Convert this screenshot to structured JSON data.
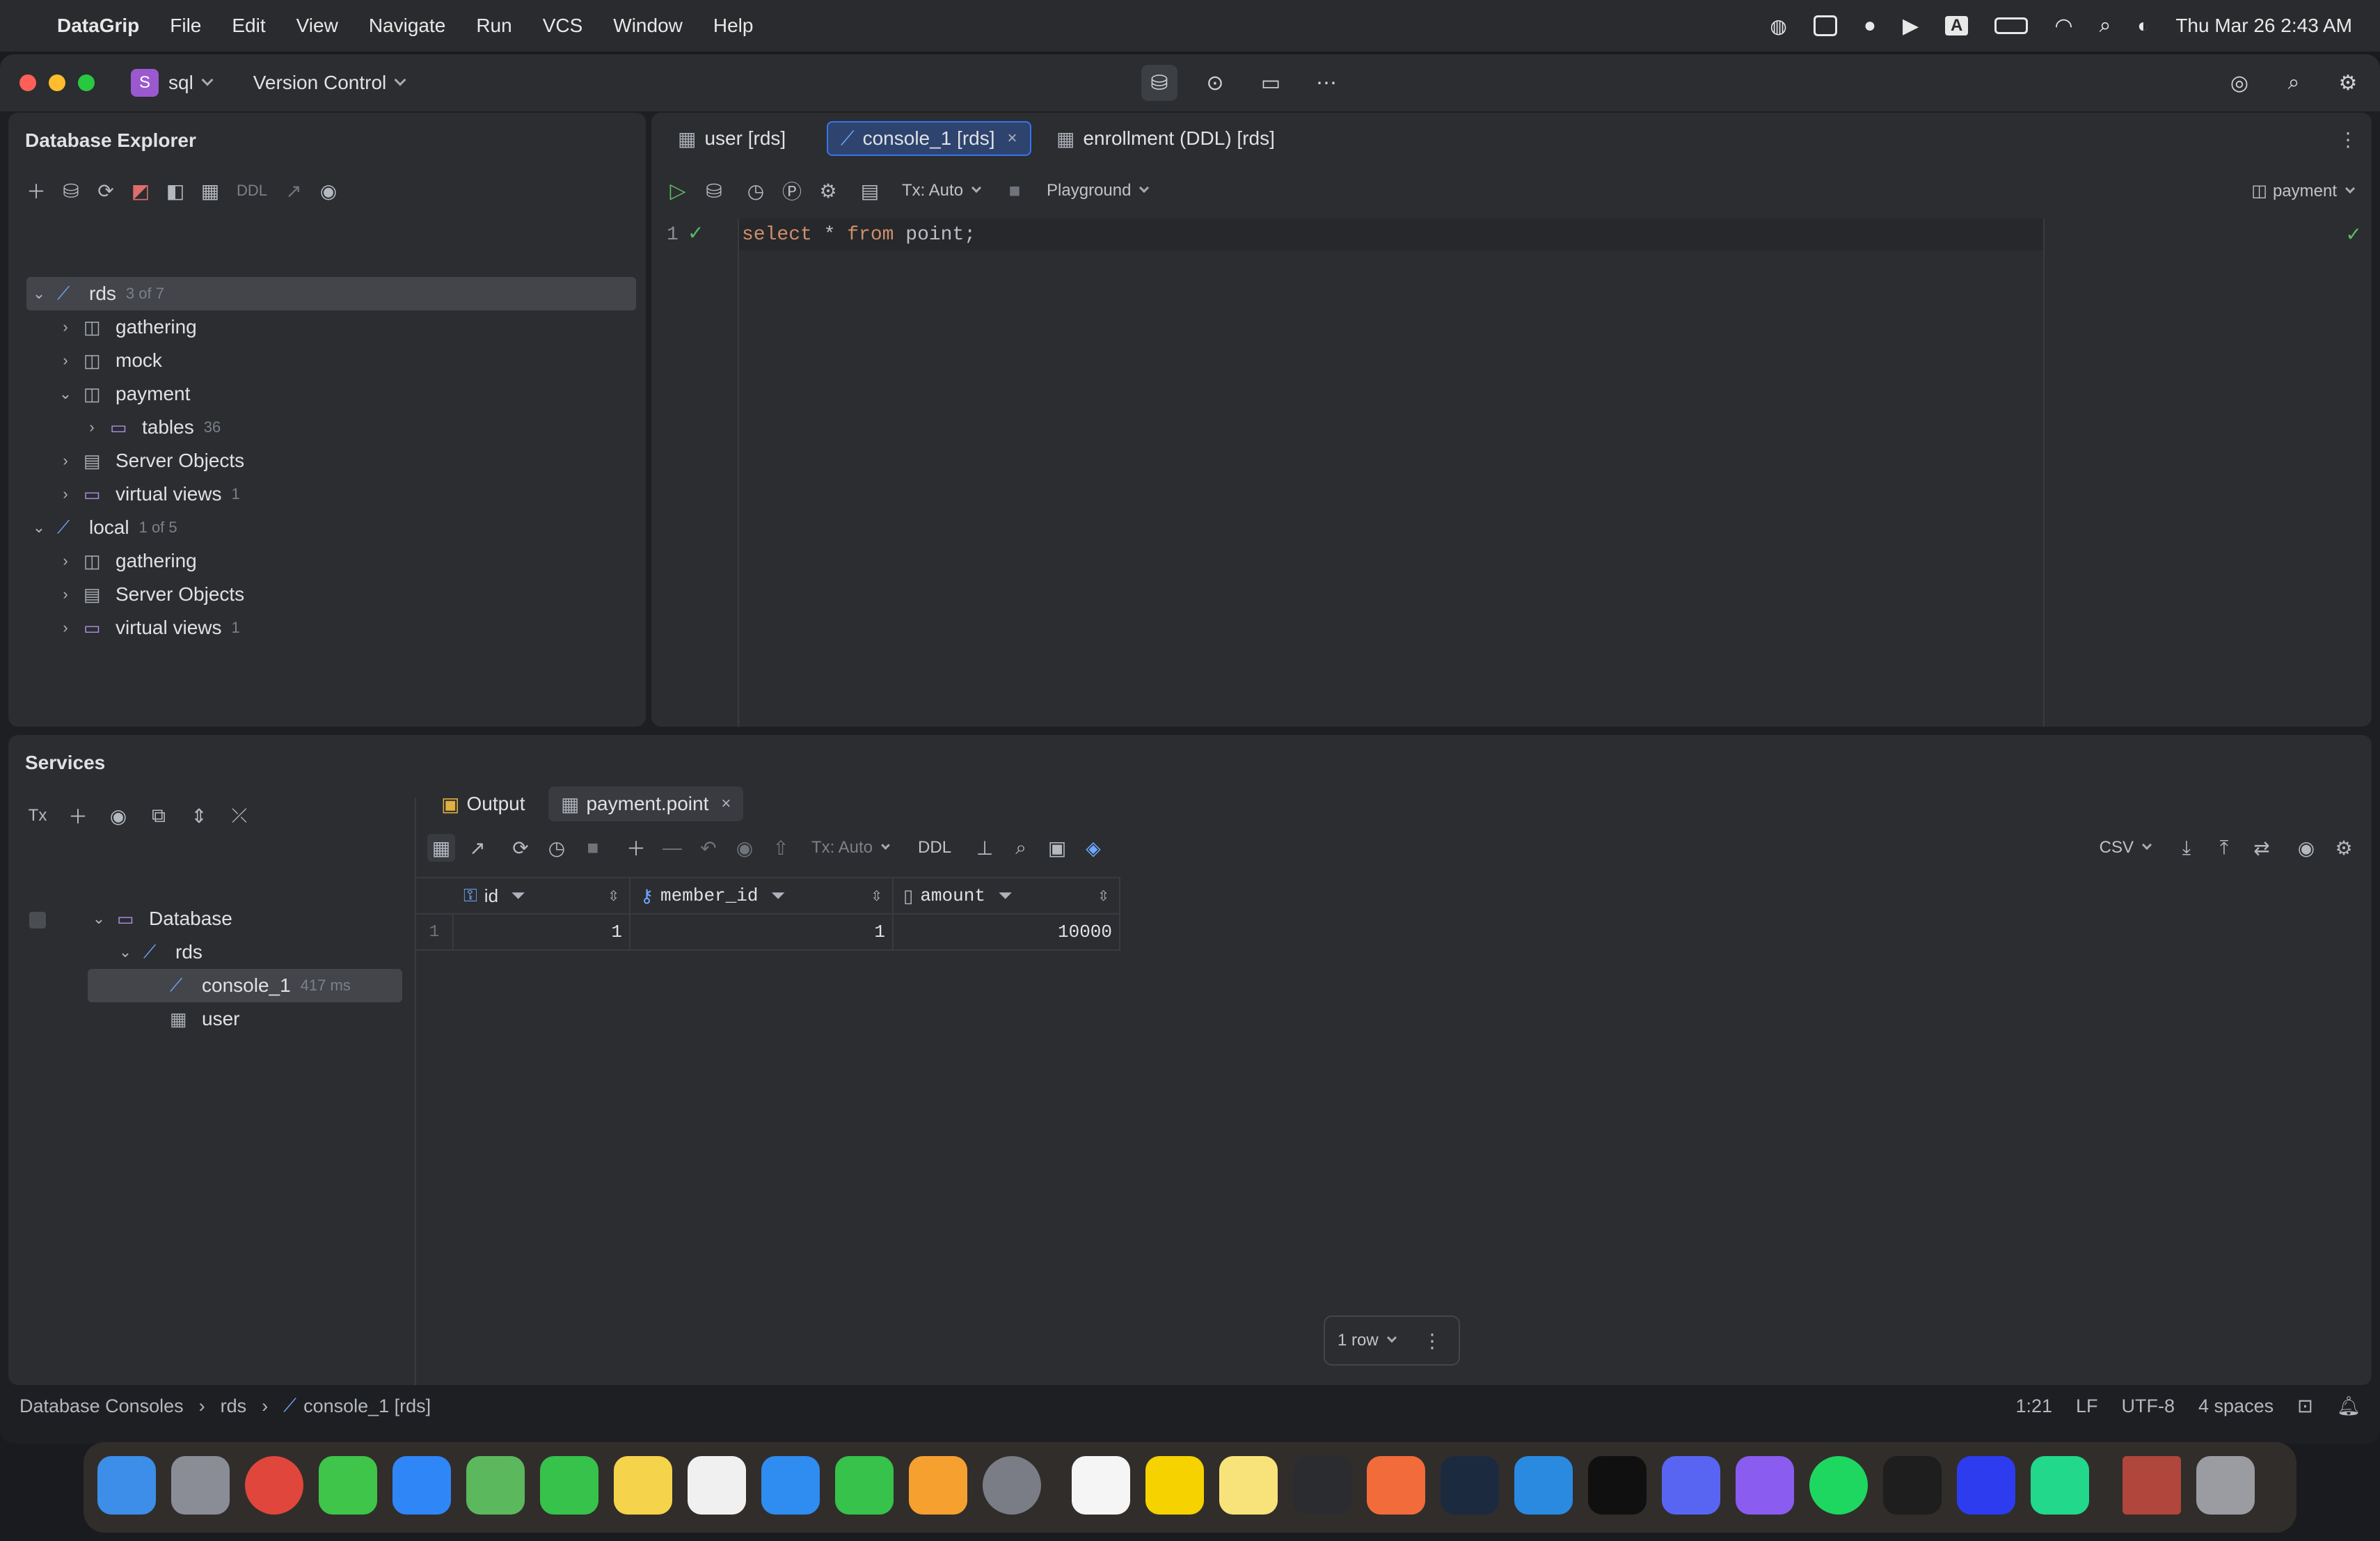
{
  "menubar": {
    "apple": "",
    "app_name": "DataGrip",
    "items": [
      "File",
      "Edit",
      "View",
      "Navigate",
      "Run",
      "VCS",
      "Window",
      "Help"
    ],
    "clock": "Thu Mar 26  2:43 AM",
    "input_source": "A"
  },
  "titlebar": {
    "project_badge": "S",
    "project_name": "sql",
    "version_control": "Version Control"
  },
  "db_explorer": {
    "title": "Database Explorer",
    "toolbar_ddl": "DDL",
    "tree": [
      {
        "label": "rds",
        "count": "3 of 7",
        "level": 0,
        "expanded": true,
        "icon": "datasource-icon",
        "selected": true
      },
      {
        "label": "gathering",
        "count": "",
        "level": 1,
        "expanded": false,
        "icon": "schema-icon"
      },
      {
        "label": "mock",
        "count": "",
        "level": 1,
        "expanded": false,
        "icon": "schema-icon"
      },
      {
        "label": "payment",
        "count": "",
        "level": 1,
        "expanded": true,
        "icon": "schema-icon"
      },
      {
        "label": "tables",
        "count": "36",
        "level": 2,
        "expanded": false,
        "icon": "folder-icon"
      },
      {
        "label": "Server Objects",
        "count": "",
        "level": 1,
        "expanded": false,
        "icon": "server-objects-icon"
      },
      {
        "label": "virtual views",
        "count": "1",
        "level": 1,
        "expanded": false,
        "icon": "folder-icon"
      },
      {
        "label": "local",
        "count": "1 of 5",
        "level": 0,
        "expanded": true,
        "icon": "datasource-icon"
      },
      {
        "label": "gathering",
        "count": "",
        "level": 1,
        "expanded": false,
        "icon": "schema-icon"
      },
      {
        "label": "Server Objects",
        "count": "",
        "level": 1,
        "expanded": false,
        "icon": "server-objects-icon"
      },
      {
        "label": "virtual views",
        "count": "1",
        "level": 1,
        "expanded": false,
        "icon": "folder-icon"
      }
    ]
  },
  "editor": {
    "tabs": [
      {
        "label": "user [rds]",
        "active": false
      },
      {
        "label": "console_1 [rds]",
        "active": true
      },
      {
        "label": "enrollment (DDL) [rds]",
        "active": false
      }
    ],
    "tx_mode": "Tx: Auto",
    "playground": "Playground",
    "schema": "payment",
    "line_number": "1",
    "code": {
      "kw1": "select",
      "star": " * ",
      "kw2": "from",
      "ident": " point",
      "semi": ";"
    }
  },
  "services": {
    "title": "Services",
    "tx_label": "Tx",
    "tree": [
      {
        "label": "Database",
        "level": 0,
        "icon": "folder-icon",
        "extra": ""
      },
      {
        "label": "rds",
        "level": 1,
        "icon": "datasource-icon",
        "extra": ""
      },
      {
        "label": "console_1",
        "level": 2,
        "icon": "console-icon",
        "extra": "417 ms",
        "selected": true
      },
      {
        "label": "user",
        "level": 2,
        "icon": "table-icon",
        "extra": ""
      }
    ],
    "tabs": [
      {
        "label": "Output",
        "active": false
      },
      {
        "label": "payment.point",
        "active": true
      }
    ],
    "toolbar_tx": "Tx: Auto",
    "toolbar_ddl": "DDL",
    "export_format": "CSV",
    "columns": [
      "id",
      "member_id",
      "amount"
    ],
    "rows": [
      {
        "num": "1",
        "cells": [
          "1",
          "1",
          "10000"
        ]
      }
    ],
    "row_count": "1 row"
  },
  "statusbar": {
    "breadcrumb": [
      "Database Consoles",
      "rds",
      "console_1 [rds]"
    ],
    "position": "1:21",
    "line_sep": "LF",
    "encoding": "UTF-8",
    "indent": "4 spaces"
  },
  "colors": {
    "accent": "#3574f0",
    "run_green": "#5fb865",
    "keyword": "#cf8e6d"
  }
}
